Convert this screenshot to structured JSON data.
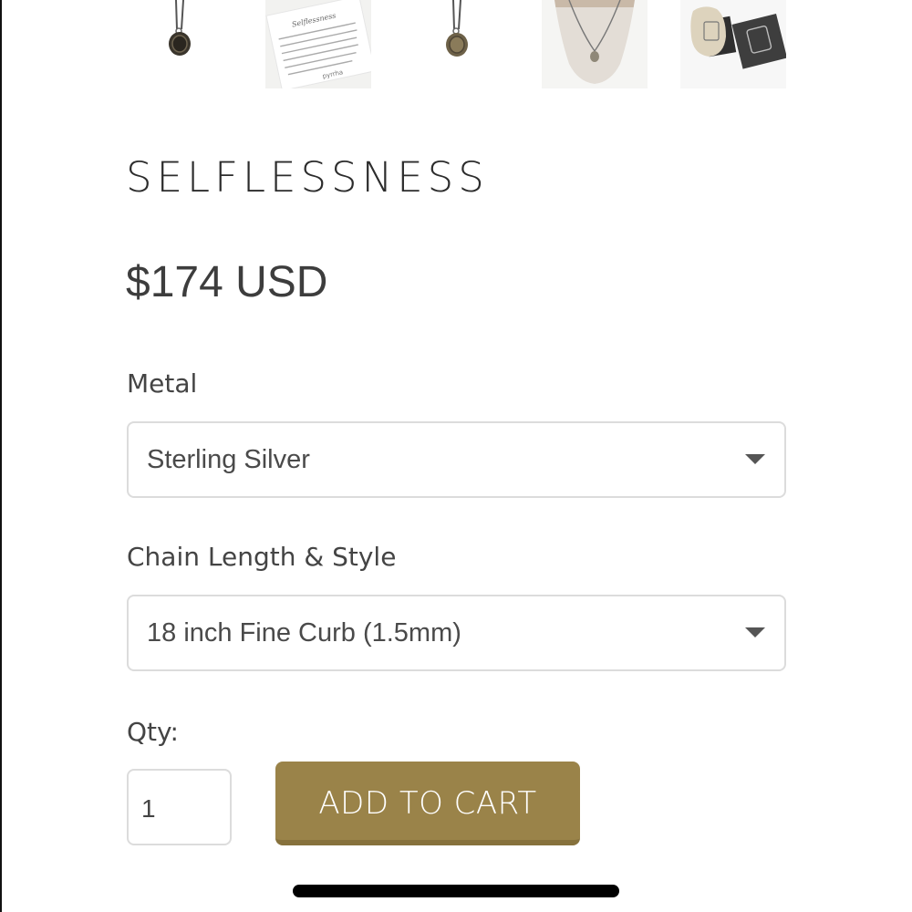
{
  "product": {
    "title": "SELFLESSNESS",
    "price": "$174 USD"
  },
  "thumbnails": [
    {
      "name": "pendant-front"
    },
    {
      "name": "meaning-card",
      "card_title": "Selflessness",
      "card_text": "This talisman reads \"Non Sibi\" in Latin, meaning \"Not for Self\". The pelican pulling out its feathers for its young is symbolic of self sacrifice for the care of others.",
      "brand": "pyrrha"
    },
    {
      "name": "pendant-back"
    },
    {
      "name": "model-wearing"
    },
    {
      "name": "packaging"
    }
  ],
  "options": {
    "metal": {
      "label": "Metal",
      "selected": "Sterling Silver"
    },
    "chain": {
      "label": "Chain Length & Style",
      "selected": "18 inch Fine Curb (1.5mm)"
    }
  },
  "qty": {
    "label": "Qty:",
    "value": "1"
  },
  "cart": {
    "button_label": "ADD TO CART"
  },
  "colors": {
    "accent": "#9a8349",
    "border": "#dcdcdc",
    "text": "#333333"
  }
}
